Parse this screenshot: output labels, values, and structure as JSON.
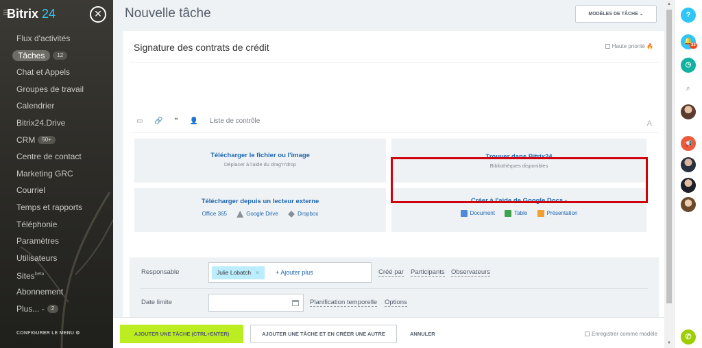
{
  "sidebar": {
    "logo_main": "Bitrix",
    "logo_accent": "24",
    "menu": [
      {
        "label": "Flux d'activités"
      },
      {
        "label": "Tâches",
        "count": "12",
        "active": true
      },
      {
        "label": "Chat et Appels"
      },
      {
        "label": "Groupes de travail"
      },
      {
        "label": "Calendrier"
      },
      {
        "label": "Bitrix24.Drive"
      },
      {
        "label": "CRM",
        "count": "50+"
      },
      {
        "label": "Centre de contact"
      },
      {
        "label": "Marketing GRC"
      },
      {
        "label": "Courriel"
      },
      {
        "label": "Temps et rapports"
      },
      {
        "label": "Téléphonie"
      },
      {
        "label": "Paramètres"
      },
      {
        "label": "Utilisateurs"
      },
      {
        "label": "Sites",
        "sup": "beta"
      },
      {
        "label": "Abonnement"
      },
      {
        "label": "Plus... -",
        "count": "2"
      }
    ],
    "configure": "CONFIGURER LE MENU"
  },
  "header": {
    "title": "Nouvelle tâche",
    "templates_button": "MODÈLES DE TÂCHE"
  },
  "task": {
    "title": "Signature des contrats de crédit",
    "high_priority": "Haute priorité"
  },
  "toolbar": {
    "checklist": "Liste de contrôle",
    "font_button": "A"
  },
  "upload": {
    "file_title": "Télécharger le fichier ou l'image",
    "file_sub": "Déplacer à l'aide du drag'n'drop",
    "find_title": "Trouver dans Bitrix24",
    "find_sub": "Bibliothèques disponibles",
    "external_title": "Télécharger depuis un lecteur externe",
    "external_links": [
      "Office 365",
      "Google Drive",
      "Dropbox"
    ],
    "google_title": "Créer à l'aide de Google Docs -",
    "google_links": [
      "Document",
      "Table",
      "Présentation"
    ]
  },
  "form": {
    "responsible_label": "Responsable",
    "responsible_chip": "Julie Lobatch",
    "add_more": "+ Ajouter plus",
    "links": [
      "Créé par",
      "Participants",
      "Observateurs"
    ],
    "deadline_label": "Date limite",
    "deadline_links": [
      "Planification temporelle",
      "Options"
    ]
  },
  "footer": {
    "add_task": "AJOUTER UNE TÂCHE (CTRL+ENTER)",
    "add_another": "AJOUTER UNE TÂCHE ET EN CRÉER UNE AUTRE",
    "cancel": "ANNULER",
    "save_template": "Enregistrer comme modèle"
  },
  "rail": {
    "help": "?",
    "notif_count": "33"
  },
  "colors": {
    "accent": "#2fc6f6",
    "primary_button": "#bbed21",
    "link": "#2067b0",
    "highlight": "#d0000c"
  }
}
